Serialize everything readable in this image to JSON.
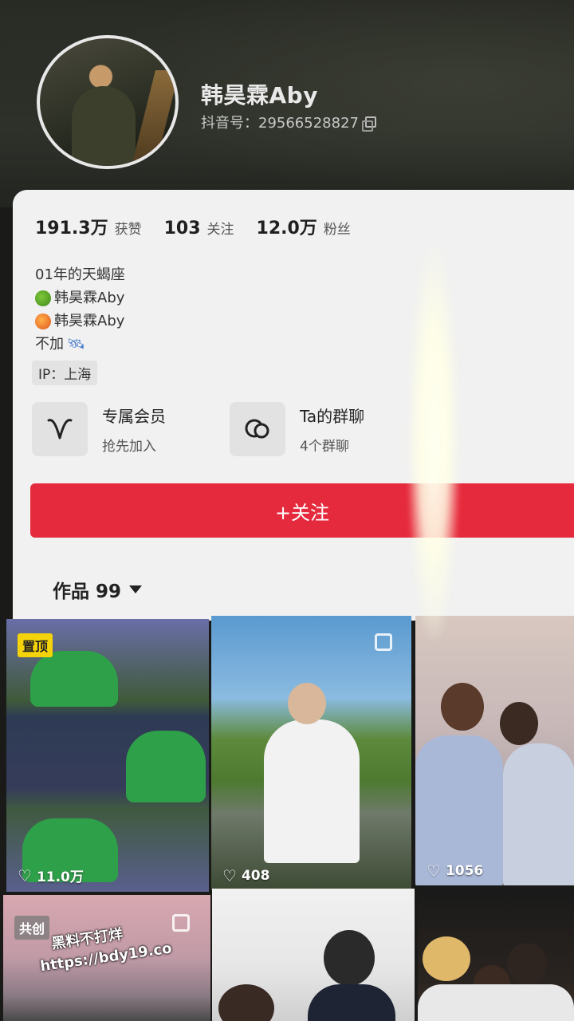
{
  "profile": {
    "nickname": "韩昊霖Aby",
    "douyin_id": "抖音号：29566528827"
  },
  "stats": [
    {
      "value": "191.3万",
      "label": "获赞"
    },
    {
      "value": "103",
      "label": "关注"
    },
    {
      "value": "12.0万",
      "label": "粉丝"
    }
  ],
  "bio": {
    "line1": "01年的天蝎座",
    "line2": "韩昊霖Aby",
    "line3": "韩昊霖Aby",
    "line4": "不加"
  },
  "ip": "IP：上海",
  "features": {
    "member": {
      "title": "专属会员",
      "subtitle": "抢先加入",
      "icon": "v-heart-icon"
    },
    "group": {
      "title": "Ta的群聊",
      "subtitle": "4个群聊",
      "icon": "chat-bubble-icon"
    }
  },
  "follow_button": "+关注",
  "works": {
    "label": "作品 99"
  },
  "grid": [
    {
      "likes": "11.0万",
      "badge": "置顶"
    },
    {
      "likes": "408"
    },
    {
      "likes": "1056"
    },
    {
      "badge": "共创"
    }
  ],
  "watermark": {
    "line1": "黑料不打烊",
    "line2": "https://bdy19.co"
  },
  "colors": {
    "accent": "#e62a3d",
    "pin_badge": "#f5d30a"
  }
}
